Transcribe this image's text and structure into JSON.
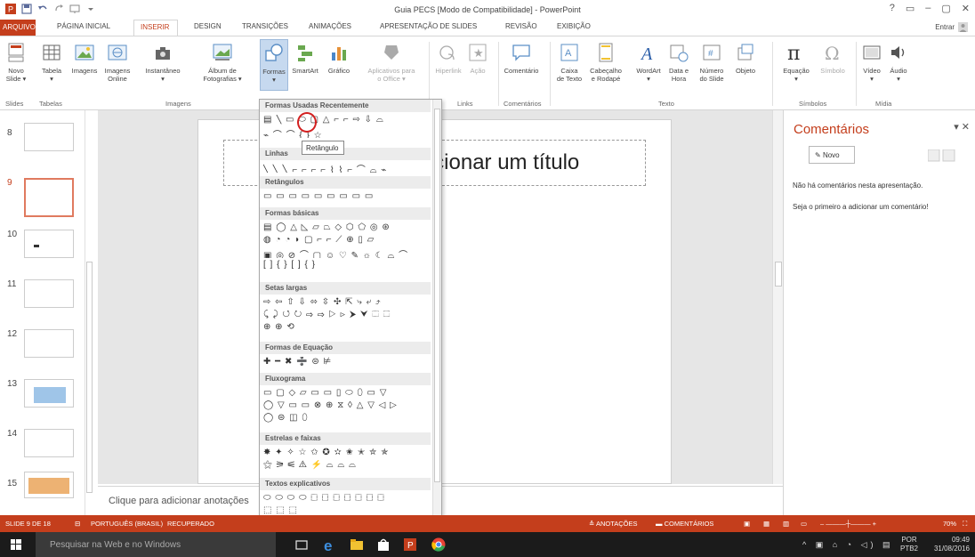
{
  "window": {
    "title": "Guia PECS [Modo de Compatibilidade] - PowerPoint",
    "controls": [
      "?",
      "▭",
      "–",
      "▢",
      "✕"
    ],
    "sign_in": "Entrar"
  },
  "tabs": [
    {
      "label": "ARQUIVO"
    },
    {
      "label": "PÁGINA INICIAL"
    },
    {
      "label": "INSERIR"
    },
    {
      "label": "DESIGN"
    },
    {
      "label": "TRANSIÇÕES"
    },
    {
      "label": "ANIMAÇÕES"
    },
    {
      "label": "APRESENTAÇÃO DE SLIDES"
    },
    {
      "label": "REVISÃO"
    },
    {
      "label": "EXIBIÇÃO"
    }
  ],
  "ribbon": {
    "buttons": [
      {
        "label": "Novo\nSlide ▾",
        "icon": "new-slide-icon"
      },
      {
        "label": "Tabela\n▾",
        "icon": "table-icon"
      },
      {
        "label": "Imagens",
        "icon": "pictures-icon"
      },
      {
        "label": "Imagens\nOnline",
        "icon": "online-pictures-icon"
      },
      {
        "label": "Instantâneo\n▾",
        "icon": "screenshot-icon"
      },
      {
        "label": "Álbum de\nFotografias ▾",
        "icon": "photo-album-icon"
      },
      {
        "label": "Formas\n▾",
        "icon": "shapes-icon"
      },
      {
        "label": "SmartArt",
        "icon": "smartart-icon"
      },
      {
        "label": "Gráfico",
        "icon": "chart-icon"
      },
      {
        "label": "Aplicativos para\no Office ▾",
        "icon": "apps-icon"
      },
      {
        "label": "Hiperlink",
        "icon": "hyperlink-icon"
      },
      {
        "label": "Ação",
        "icon": "action-icon"
      },
      {
        "label": "Comentário",
        "icon": "comment-icon"
      },
      {
        "label": "Caixa\nde Texto",
        "icon": "textbox-icon"
      },
      {
        "label": "Cabeçalho\ne Rodapé",
        "icon": "header-footer-icon"
      },
      {
        "label": "WordArt\n▾",
        "icon": "wordart-icon"
      },
      {
        "label": "Data e\nHora",
        "icon": "date-time-icon"
      },
      {
        "label": "Número\ndo Slide",
        "icon": "slide-number-icon"
      },
      {
        "label": "Objeto",
        "icon": "object-icon"
      },
      {
        "label": "Equação\n▾",
        "icon": "equation-icon"
      },
      {
        "label": "Símbolo",
        "icon": "symbol-icon"
      },
      {
        "label": "Vídeo\n▾",
        "icon": "video-icon"
      },
      {
        "label": "Áudio\n▾",
        "icon": "audio-icon"
      }
    ],
    "groups": [
      "Slides",
      "Tabelas",
      "Imagens",
      "Links",
      "Comentários",
      "Texto",
      "Símbolos",
      "Mídia"
    ]
  },
  "thumbnails": [
    {
      "number": "8"
    },
    {
      "number": "9"
    },
    {
      "number": "10"
    },
    {
      "number": "11"
    },
    {
      "number": "12"
    },
    {
      "number": "13"
    },
    {
      "number": "14"
    },
    {
      "number": "15"
    }
  ],
  "slide": {
    "title_placeholder": "Clique para adicionar um título"
  },
  "notes": {
    "placeholder": "Clique para adicionar anotações"
  },
  "comments": {
    "title": "Comentários",
    "new_button": "Novo",
    "empty_line1": "Não há comentários nesta apresentação.",
    "empty_line2": "Seja o primeiro a adicionar um comentário!"
  },
  "gallery": {
    "tooltip": "Retângulo",
    "sections": [
      {
        "title": "Formas Usadas Recentemente",
        "rows": [
          "▤ ╲ ▭ ⬭ ▢ △ ⌐ ⌐ ⇨ ⇩ ⌓",
          "⌁ ⌒ ⌒ { } ☆"
        ]
      },
      {
        "title": "Linhas",
        "rows": [
          "╲ ╲ ╲ ⌐ ⌐ ⌐ ⌐ ⌇ ⌇ ⌐ ⌒ ⌓ ⌁"
        ]
      },
      {
        "title": "Retângulos",
        "rows": [
          "▭ ▭ ▭ ▭ ▭ ▭ ▭ ▭ ▭"
        ]
      },
      {
        "title": "Formas básicas",
        "rows": [
          "▤ ◯ △ ◺ ▱ ⏢ ◇ ⬡ ⬠ ◎ ⊛",
          "◍ ◔ ◔ ◗ ▢ ⌐ ⌐ ⟋ ⊕ ▯ ▱",
          "▣ ◎ ⊘ ⌒ ▢ ☺ ♡ ✎ ☼ ☾ ⌓ ⌒",
          "[ ] { } [ ] { }"
        ]
      },
      {
        "title": "Setas largas",
        "rows": [
          "⇨ ⇦ ⇧ ⇩ ⬄ ⇳ ✣ ⇱ ⤷ ⤶ ⤴",
          "⤹ ⤸ ↺ ↻ ⇨ ⇨ ▷ ⊳ ⮞ ⮟ ⬚ ⬚",
          "⊕ ⊕ ⟲"
        ]
      },
      {
        "title": "Formas de Equação",
        "rows": [
          "✚ ━ ✖ ➗ ⊜ ⊭"
        ]
      },
      {
        "title": "Fluxograma",
        "rows": [
          "▭ ▢ ◇ ▱ ▭ ▭ ▯ ⬭ ⬯ ▭ ▽",
          "◯ ▽ ▭ ▭ ⊗ ⊕ ⧖ ◊ △ ▽ ◁ ▷",
          "◯ ⊜ ◫ ⬯"
        ]
      },
      {
        "title": "Estrelas e faixas",
        "rows": [
          "✸ ✦ ✧ ☆ ✩ ✪ ✫ ✬ ✭ ✮ ✯",
          "⚝ ⚞ ⚟ ⚠ ⚡ ⌓ ⌓ ⌓"
        ]
      },
      {
        "title": "Textos explicativos",
        "rows": [
          "⬭ ⬭ ⬭ ⬭ ⬚ ⬚ ⬚ ⬚ ⬚ ⬚ ⬚",
          "⬚ ⬚ ⬚"
        ]
      }
    ]
  },
  "statusbar": {
    "slide": "SLIDE 9 DE 18",
    "language": "PORTUGUÊS (BRASIL)",
    "recovered": "RECUPERADO",
    "notes": "≙ ANOTAÇÕES",
    "comments": "▬ COMENTÁRIOS",
    "zoom": "70%"
  },
  "taskbar": {
    "search_placeholder": "Pesquisar na Web e no Windows",
    "language": "POR",
    "keyboard": "PTB2",
    "time": "09:49",
    "date": "31/08/2016"
  },
  "colors": {
    "accent": "#c43e1c",
    "selection": "#c6d9ef"
  }
}
